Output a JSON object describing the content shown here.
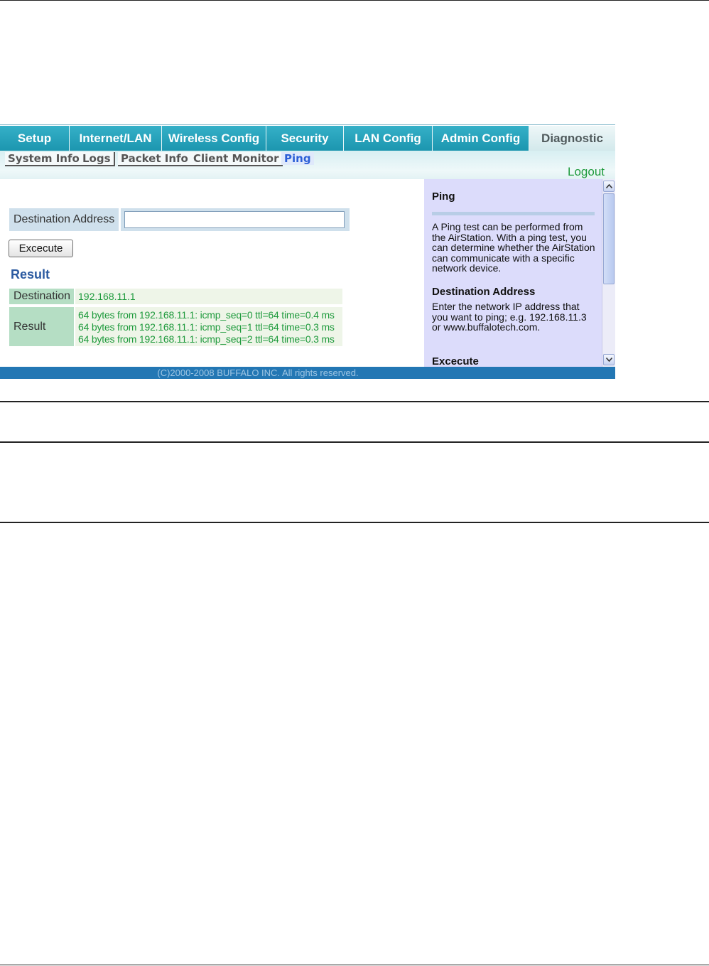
{
  "tabs": [
    "Setup",
    "Internet/LAN",
    "Wireless Config",
    "Security",
    "LAN Config",
    "Admin Config",
    "Diagnostic"
  ],
  "subtabs": [
    "System Info",
    "Logs",
    "Packet Info",
    "Client Monitor",
    "Ping"
  ],
  "logout": "Logout",
  "form": {
    "dest_label": "Destination Address",
    "dest_value": "",
    "execute_label": "Excecute"
  },
  "result": {
    "title": "Result",
    "destination_label": "Destination",
    "destination_value": "192.168.11.1",
    "result_label": "Result",
    "lines": [
      "64 bytes from 192.168.11.1: icmp_seq=0 ttl=64 time=0.4 ms",
      "64 bytes from 192.168.11.1: icmp_seq=1 ttl=64 time=0.3 ms",
      "64 bytes from 192.168.11.1: icmp_seq=2 ttl=64 time=0.3 ms"
    ]
  },
  "help": {
    "ping_title": "Ping",
    "ping_text": "A Ping test can be performed from the AirStation. With a ping test, you can determine whether the AirStation can communicate with a specific network device.",
    "dest_title": "Destination Address",
    "dest_text": "Enter the network IP address that you want to ping; e.g. 192.168.11.3 or www.buffalotech.com.",
    "exec_title": "Excecute"
  },
  "footer": "(C)2000-2008 BUFFALO INC. All rights reserved."
}
